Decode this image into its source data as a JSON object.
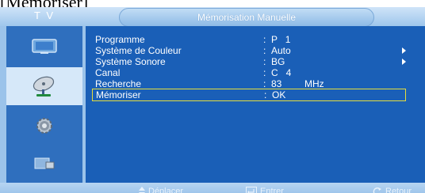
{
  "header_bracket": "[Mémoriser]",
  "top_bar": {
    "section_label": "T V",
    "title": "Mémorisation Manuelle"
  },
  "sidebar": {
    "items": [
      {
        "icon": "picture-icon",
        "active": false
      },
      {
        "icon": "satellite-dish-icon",
        "active": true
      },
      {
        "icon": "gear-icon",
        "active": false
      },
      {
        "icon": "input-icon",
        "active": false
      }
    ]
  },
  "menu": {
    "rows": [
      {
        "label": "Programme",
        "colon": ":",
        "value": "P   1",
        "unit": "",
        "arrow": false,
        "selected": false
      },
      {
        "label": "Système de Couleur",
        "colon": ":",
        "value": "Auto",
        "unit": "",
        "arrow": true,
        "selected": false
      },
      {
        "label": "Système Sonore",
        "colon": ":",
        "value": "BG",
        "unit": "",
        "arrow": true,
        "selected": false
      },
      {
        "label": "Canal",
        "colon": ":",
        "value": "C   4",
        "unit": "",
        "arrow": false,
        "selected": false
      },
      {
        "label": "Recherche",
        "colon": ":",
        "value": "83",
        "unit": "MHz",
        "arrow": false,
        "selected": false
      },
      {
        "label": "Mémoriser",
        "colon": ":",
        "value": "OK",
        "unit": "",
        "arrow": false,
        "selected": true
      }
    ]
  },
  "bottom_bar": {
    "move_label": "Déplacer",
    "enter_label": "Entrer",
    "return_label": "Retour"
  },
  "colors": {
    "osd_background": "#9bc3ea",
    "sidebar": "#2f6fbe",
    "content": "#1a5fb7",
    "selection_border": "#e6dd3c"
  }
}
